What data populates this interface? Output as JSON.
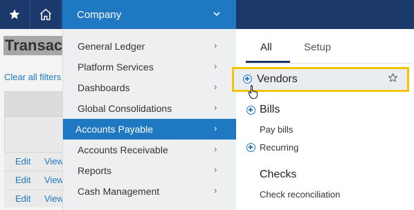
{
  "topbar": {
    "company_label": "Company"
  },
  "background": {
    "title": "Transac",
    "clear_filters": "Clear all filters",
    "rows": [
      {
        "edit": "Edit",
        "view": "View"
      },
      {
        "edit": "Edit",
        "view": "View"
      },
      {
        "edit": "Edit",
        "view": "View"
      }
    ]
  },
  "menu": {
    "items": [
      {
        "label": "General Ledger"
      },
      {
        "label": "Platform Services"
      },
      {
        "label": "Dashboards"
      },
      {
        "label": "Global Consolidations"
      },
      {
        "label": "Accounts Payable"
      },
      {
        "label": "Accounts Receivable"
      },
      {
        "label": "Reports"
      },
      {
        "label": "Cash Management"
      }
    ],
    "active_index": 4
  },
  "submenu": {
    "tabs": [
      {
        "label": "All"
      },
      {
        "label": "Setup"
      }
    ],
    "vendors_label": "Vendors",
    "bills_label": "Bills",
    "pay_bills_label": "Pay bills",
    "recurring_label": "Recurring",
    "checks_label": "Checks",
    "check_reconciliation_label": "Check reconciliation"
  },
  "colors": {
    "topbar": "#1b3a6b",
    "accent": "#1e78c2",
    "highlight_border": "#f5c400"
  }
}
